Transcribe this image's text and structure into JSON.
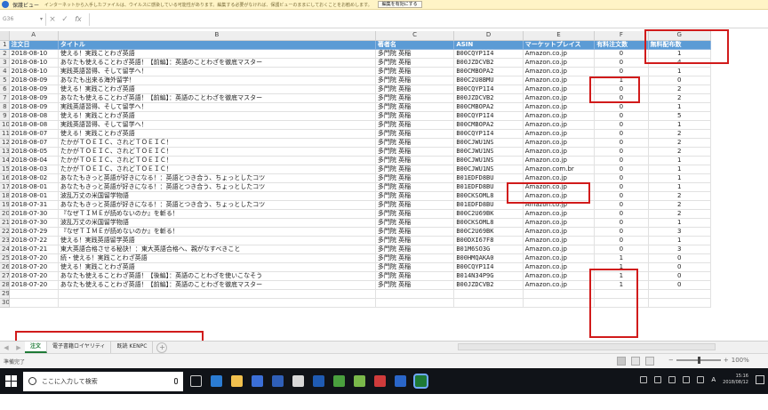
{
  "warning_bar": {
    "label": "保護ビュー",
    "message": "インターネットから入手したファイルは、ウイルスに感染している可能性があります。編集する必要がなければ、保護ビューのままにしておくことをお勧めします。",
    "button": "編集を有効にする"
  },
  "formula_bar": {
    "name_box": "G36",
    "cancel": "×",
    "enter": "✓",
    "fx": "fx",
    "value": ""
  },
  "columns": [
    "A",
    "B",
    "C",
    "D",
    "E",
    "F",
    "G"
  ],
  "header_row": {
    "rownum": "1",
    "cells": [
      "注文日",
      "タイトル",
      "著者名",
      "ASIN",
      "マーケットプレイス",
      "有料注文数",
      "無料配布数"
    ]
  },
  "rows": [
    {
      "n": "2",
      "c": [
        "2018-08-10",
        "使える！実践ことわざ英語",
        "多門院 英稲",
        "B00CQYP1I4",
        "Amazon.co.jp",
        "0",
        "1"
      ]
    },
    {
      "n": "3",
      "c": [
        "2018-08-10",
        "あなたも使えることわざ英語！【前編】：英語のことわざを徹底マスター",
        "多門院 英稲",
        "B00JZDCVB2",
        "Amazon.co.jp",
        "0",
        "4"
      ]
    },
    {
      "n": "4",
      "c": [
        "2018-08-10",
        "実践英語習得、そして留学へ！",
        "多門院 英稲",
        "B00CMBOPA2",
        "Amazon.co.jp",
        "0",
        "1"
      ]
    },
    {
      "n": "5",
      "c": [
        "2018-08-09",
        "あなたも出来る海外留学！",
        "多門院 英稲",
        "B00C2U8BMU",
        "Amazon.co.jp",
        "1",
        "0"
      ]
    },
    {
      "n": "6",
      "c": [
        "2018-08-09",
        "使える！実践ことわざ英語",
        "多門院 英稲",
        "B00CQYP1I4",
        "Amazon.co.jp",
        "0",
        "2"
      ]
    },
    {
      "n": "7",
      "c": [
        "2018-08-09",
        "あなたも使えることわざ英語！【前編】：英語のことわざを徹底マスター",
        "多門院 英稲",
        "B00JZDCVB2",
        "Amazon.co.jp",
        "0",
        "2"
      ]
    },
    {
      "n": "8",
      "c": [
        "2018-08-09",
        "実践英語習得、そして留学へ！",
        "多門院 英稲",
        "B00CMBOPA2",
        "Amazon.co.jp",
        "0",
        "1"
      ]
    },
    {
      "n": "9",
      "c": [
        "2018-08-08",
        "使える！実践ことわざ英語",
        "多門院 英稲",
        "B00CQYP1I4",
        "Amazon.co.jp",
        "0",
        "5"
      ]
    },
    {
      "n": "10",
      "c": [
        "2018-08-08",
        "実践英語習得、そして留学へ！",
        "多門院 英稲",
        "B00CMBOPA2",
        "Amazon.co.jp",
        "0",
        "1"
      ]
    },
    {
      "n": "11",
      "c": [
        "2018-08-07",
        "使える！実践ことわざ英語",
        "多門院 英稲",
        "B00CQYP1I4",
        "Amazon.co.jp",
        "0",
        "2"
      ]
    },
    {
      "n": "12",
      "c": [
        "2018-08-07",
        "たかがＴＯＥＩＣ、されどＴＯＥＩＣ！",
        "多門院 英稲",
        "B00CJWU1NS",
        "Amazon.co.jp",
        "0",
        "2"
      ]
    },
    {
      "n": "13",
      "c": [
        "2018-08-05",
        "たかがＴＯＥＩＣ、されどＴＯＥＩＣ！",
        "多門院 英稲",
        "B00CJWU1NS",
        "Amazon.co.jp",
        "0",
        "2"
      ]
    },
    {
      "n": "14",
      "c": [
        "2018-08-04",
        "たかがＴＯＥＩＣ、されどＴＯＥＩＣ！",
        "多門院 英稲",
        "B00CJWU1NS",
        "Amazon.co.jp",
        "0",
        "1"
      ]
    },
    {
      "n": "15",
      "c": [
        "2018-08-03",
        "たかがＴＯＥＩＣ、されどＴＯＥＩＣ！",
        "多門院 英稲",
        "B00CJWU1NS",
        "Amazon.com.br",
        "0",
        "1"
      ]
    },
    {
      "n": "16",
      "c": [
        "2018-08-02",
        "あなたもきっと英語が好きになる！：英語とつき合う、ちょっとしたコツ",
        "多門院 英稲",
        "B01EDFD8BU",
        "Amazon.co.jp",
        "0",
        "1"
      ]
    },
    {
      "n": "17",
      "c": [
        "2018-08-01",
        "あなたもきっと英語が好きになる！：英語とつき合う、ちょっとしたコツ",
        "多門院 英稲",
        "B01EDFD8BU",
        "Amazon.co.jp",
        "0",
        "1"
      ]
    },
    {
      "n": "18",
      "c": [
        "2018-08-01",
        "波乱万丈の米国留学物語",
        "多門院 英稲",
        "B00CKSOML8",
        "Amazon.co.jp",
        "0",
        "2"
      ]
    },
    {
      "n": "19",
      "c": [
        "2018-07-31",
        "あなたもきっと英語が好きになる！：英語とつき合う、ちょっとしたコツ",
        "多門院 英稲",
        "B01EDFD8BU",
        "Amazon.co.jp",
        "0",
        "2"
      ]
    },
    {
      "n": "20",
      "c": [
        "2018-07-30",
        "『なぜＴＩＭＥが読めないのか』を斬る！",
        "多門院 英稲",
        "B00C2U69BK",
        "Amazon.co.jp",
        "0",
        "2"
      ]
    },
    {
      "n": "21",
      "c": [
        "2018-07-30",
        "波乱万丈の米国留学物語",
        "多門院 英稲",
        "B00CKSOML8",
        "Amazon.co.jp",
        "0",
        "1"
      ]
    },
    {
      "n": "22",
      "c": [
        "2018-07-29",
        "『なぜＴＩＭＥが読めないのか』を斬る！",
        "多門院 英稲",
        "B00C2U69BK",
        "Amazon.co.jp",
        "0",
        "3"
      ]
    },
    {
      "n": "23",
      "c": [
        "2018-07-22",
        "使える！実践英語留学英語",
        "多門院 英稲",
        "B00DXI67F8",
        "Amazon.co.jp",
        "0",
        "1"
      ]
    },
    {
      "n": "24",
      "c": [
        "2018-07-21",
        "東大英語合格させる秘訣！：東大英語合格へ、親がなすべきこと",
        "多門院 英稲",
        "B01M6SO3G",
        "Amazon.co.jp",
        "0",
        "3"
      ]
    },
    {
      "n": "25",
      "c": [
        "2018-07-20",
        "続・使える！実践ことわざ英語",
        "多門院 英稲",
        "B00HMQAKA0",
        "Amazon.co.jp",
        "1",
        "0"
      ]
    },
    {
      "n": "26",
      "c": [
        "2018-07-20",
        "使える！実践ことわざ英語",
        "多門院 英稲",
        "B00CQYP1I4",
        "Amazon.co.jp",
        "1",
        "0"
      ]
    },
    {
      "n": "27",
      "c": [
        "2018-07-20",
        "あなたも使えることわざ英語！【後編】：英語のことわざを使いこなそう",
        "多門院 英稲",
        "B014N34P9G",
        "Amazon.co.jp",
        "1",
        "0"
      ]
    },
    {
      "n": "28",
      "c": [
        "2018-07-20",
        "あなたも使えることわざ英語！【前編】：英語のことわざを徹底マスター",
        "多門院 英稲",
        "B00JZDCVB2",
        "Amazon.co.jp",
        "1",
        "0"
      ]
    },
    {
      "n": "29",
      "c": [
        "",
        "",
        "",
        "",
        "",
        "",
        ""
      ]
    },
    {
      "n": "30",
      "c": [
        "",
        "",
        "",
        "",
        "",
        "",
        ""
      ]
    }
  ],
  "sheet_tabs": {
    "tabs": [
      "注文",
      "電子書籍ロイヤリティ",
      "既読 KENPC"
    ],
    "active": 0,
    "add": "+"
  },
  "status_bar": {
    "text": "準備完了",
    "zoom": "100%"
  },
  "taskbar": {
    "search_placeholder": "ここに入力して検索",
    "time": "15:16",
    "date": "2018/08/12",
    "ime": "A"
  },
  "colors": {
    "header_fill": "#5b9bd5",
    "highlight": "#d11b1b",
    "taskbar": "#101318"
  }
}
